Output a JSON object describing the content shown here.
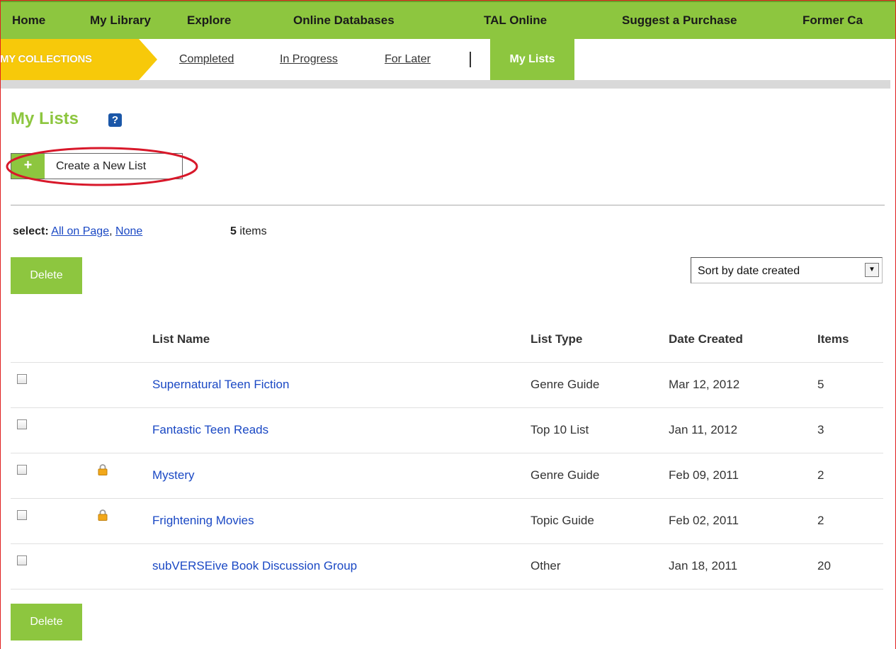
{
  "top_nav": {
    "items": [
      "Home",
      "My Library",
      "Explore",
      "Online Databases",
      "TAL Online",
      "Suggest a Purchase",
      "Former Ca"
    ]
  },
  "sub_nav": {
    "collections_label": "MY COLLECTIONS",
    "links": [
      "Completed",
      "In Progress",
      "For Later"
    ],
    "active_tab": "My Lists"
  },
  "page": {
    "title": "My Lists",
    "help_icon": "?",
    "create_button_icon": "+",
    "create_button_label": "Create a New List"
  },
  "selection": {
    "prefix": "select:",
    "all_on_page": "All on Page",
    "separator": ",",
    "none": "None",
    "item_count": "5",
    "item_count_suffix": "items"
  },
  "actions": {
    "delete_top": "Delete",
    "delete_bottom": "Delete"
  },
  "sort": {
    "selected": "Sort by date created"
  },
  "table": {
    "headers": {
      "name": "List Name",
      "type": "List Type",
      "date": "Date Created",
      "items": "Items"
    },
    "rows": [
      {
        "name": "Supernatural Teen Fiction",
        "type": "Genre Guide",
        "date": "Mar 12, 2012",
        "items": "5",
        "locked": false
      },
      {
        "name": "Fantastic Teen Reads",
        "type": "Top 10 List",
        "date": "Jan 11, 2012",
        "items": "3",
        "locked": false
      },
      {
        "name": "Mystery",
        "type": "Genre Guide",
        "date": "Feb 09, 2011",
        "items": "2",
        "locked": true
      },
      {
        "name": "Frightening Movies",
        "type": "Topic Guide",
        "date": "Feb 02, 2011",
        "items": "2",
        "locked": true
      },
      {
        "name": "subVERSEive Book Discussion Group",
        "type": "Other",
        "date": "Jan 18, 2011",
        "items": "20",
        "locked": false
      }
    ]
  },
  "colors": {
    "accent_green": "#8dc63f",
    "collections_yellow": "#f7c90a",
    "link_blue": "#1a48c4",
    "annotation_red": "#d8182a"
  }
}
